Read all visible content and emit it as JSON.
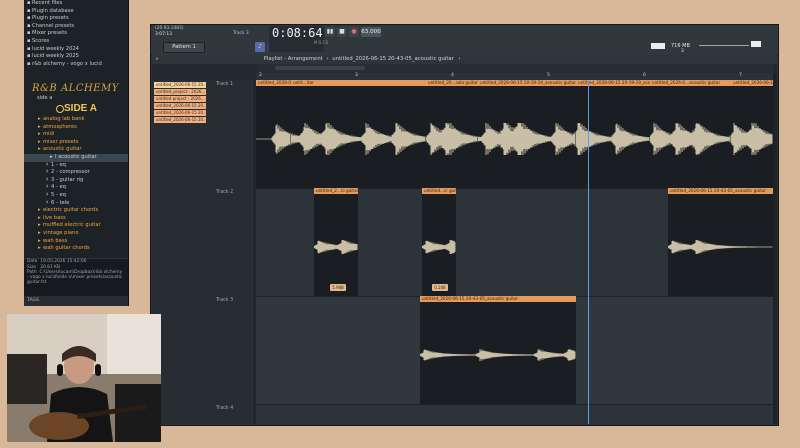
{
  "browser": {
    "items": [
      {
        "label": "Recent files",
        "style": "normal"
      },
      {
        "label": "Plugin database",
        "style": "normal"
      },
      {
        "label": "Plugin presets",
        "style": "normal"
      },
      {
        "label": "Channel presets",
        "style": "normal"
      },
      {
        "label": "Mixer presets",
        "style": "normal"
      },
      {
        "label": "Scores",
        "style": "normal"
      },
      {
        "label": "lucid weekly 2024",
        "style": "normal"
      },
      {
        "label": "lucid weekly 2025",
        "style": "normal"
      },
      {
        "label": "r&b alchemy - vogo x lucid",
        "style": "normal"
      }
    ],
    "logo_text": "R&B ALCHEMY",
    "folder_side": "side a",
    "side_title": "SIDE A",
    "sub_items": [
      {
        "label": "analog lab bank",
        "style": "orange"
      },
      {
        "label": "atmospheres",
        "style": "orange"
      },
      {
        "label": "midi",
        "style": "orange"
      },
      {
        "label": "mixer presets",
        "style": "orange"
      },
      {
        "label": "acoustic guitar",
        "style": "orange"
      },
      {
        "label": "l acoustic guitar",
        "style": "sel"
      },
      {
        "label": "1 - eq",
        "style": "normal"
      },
      {
        "label": "2 - compressor",
        "style": "normal"
      },
      {
        "label": "3 - guitar rig",
        "style": "normal"
      },
      {
        "label": "4 - eq",
        "style": "normal"
      },
      {
        "label": "5 - eq",
        "style": "normal"
      },
      {
        "label": "6 - tele",
        "style": "normal"
      },
      {
        "label": "electric guitar chords",
        "style": "orange"
      },
      {
        "label": "live bass",
        "style": "orange"
      },
      {
        "label": "muffled electric guitar",
        "style": "orange"
      },
      {
        "label": "vintage piano",
        "style": "orange"
      },
      {
        "label": "wah bass",
        "style": "orange"
      },
      {
        "label": "wah guitar chords",
        "style": "orange"
      }
    ],
    "info": {
      "date_label": "Date",
      "date_value": "19.05.2026 15:42:00",
      "size_label": "Size",
      "size_value": "20.81 KB",
      "path_label": "Path",
      "path_value": "C:\\Users\\lucam\\Dropbox\\r&b alchemy - vogo x lucid\\side a\\mixer presets\\acoustic guitar.fst"
    },
    "tags_label": "TAGS"
  },
  "toolbar": {
    "version_line1": "(20.93.1483)",
    "version_line2": "3:07:13",
    "track_indicator": "Track 3",
    "time": "0:08:64",
    "time_unit": "M:S:CS",
    "tempo": "63.000",
    "pattern_label": "Pattern 1",
    "memory": "716 MB",
    "cpu": "3"
  },
  "playlist": {
    "title": "Playlist - Arrangement",
    "breadcrumb_sep": "›",
    "clip_name": "untitled_2026-06-15 20-43-05_acoustic guitar",
    "ruler_marks": [
      "2",
      "3",
      "4",
      "5",
      "6",
      "7",
      "8"
    ],
    "pool_clips": [
      "untitled_2026-06-15 20...",
      "untitled_project - 2026...",
      "untitled project - 2026...",
      "untitled_2026-06-15 20...",
      "untitled_2026-06-15 20...",
      "untitled_2026-06-15 20..."
    ],
    "tracks": [
      {
        "name": "Track 1"
      },
      {
        "name": "Track 2"
      },
      {
        "name": "Track 3"
      },
      {
        "name": "Track 4"
      }
    ],
    "clips_track1": [
      "untitled_2026-06-15 20-19-19_acoustic guitar",
      "untit...itar",
      "untitled_20...solo guitar",
      "untitled_2026-06-15 20-19-19_acoustic guitar",
      "untitled_2026-06-15 20-19-19_acoustic guitar",
      "untitled_2026-0...acoustic guitar",
      "untitled_2026-06-15 20-..."
    ],
    "clips_track2": [
      "untitled_2...lo guitar",
      "untitled...ic guitar",
      "untitled_2026-06-15 20-43-05_acoustic guitar"
    ],
    "clip_track3": "untitled_2026-06-15 20-43-05_acoustic guitar",
    "clip_tags": [
      "5.948",
      "0.248"
    ]
  },
  "colors": {
    "accent_orange": "#e39a5b",
    "waveform": "#f5e6c8",
    "playhead": "#5aa0e6",
    "folder_orange": "#f0a53b"
  }
}
